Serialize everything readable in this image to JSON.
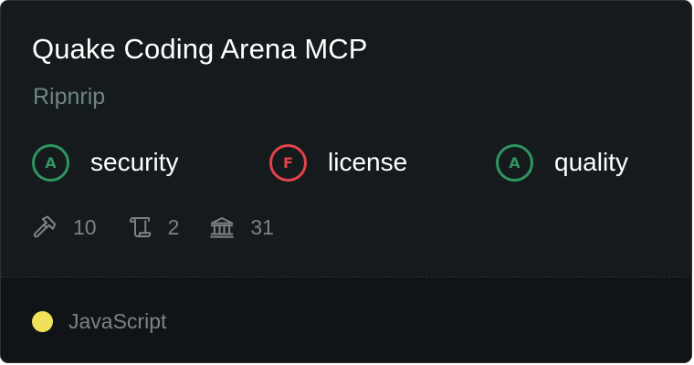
{
  "card": {
    "title": "Quake Coding Arena MCP",
    "author": "Ripnrip",
    "scores": [
      {
        "grade": "A",
        "label": "security",
        "status_color": "#2f9461"
      },
      {
        "grade": "F",
        "label": "license",
        "status_color": "#e2434a"
      },
      {
        "grade": "A",
        "label": "quality",
        "status_color": "#2f9461"
      }
    ],
    "stats": [
      {
        "icon": "hammer-icon",
        "value": "10"
      },
      {
        "icon": "scroll-icon",
        "value": "2"
      },
      {
        "icon": "bank-icon",
        "value": "31"
      }
    ],
    "language": {
      "name": "JavaScript",
      "color": "#f1e05a"
    }
  }
}
